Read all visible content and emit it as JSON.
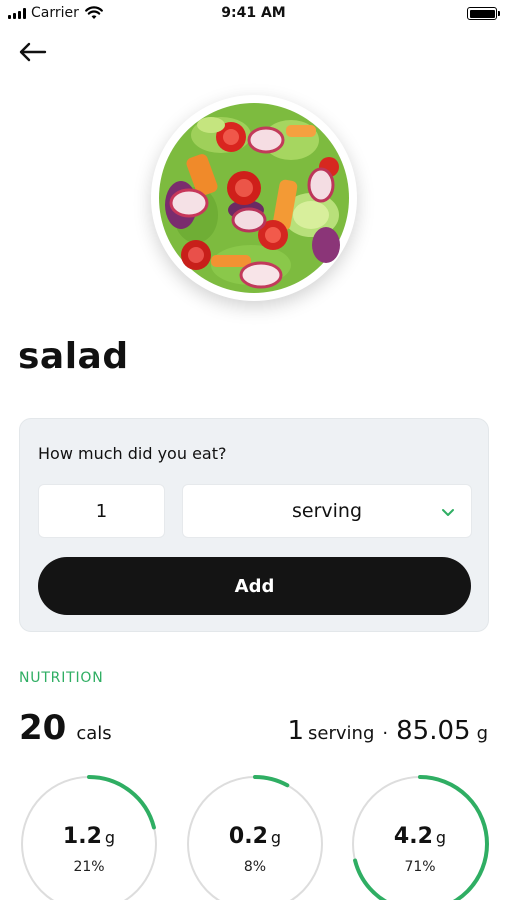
{
  "status_bar": {
    "carrier": "Carrier",
    "time": "9:41 AM"
  },
  "food": {
    "name": "salad"
  },
  "amount_card": {
    "question": "How much did you eat?",
    "quantity": "1",
    "unit": "serving",
    "add_label": "Add"
  },
  "nutrition": {
    "section_label": "NUTRITION",
    "calories_value": "20",
    "calories_unit": "cals",
    "serving_qty": "1",
    "serving_unit": "serving",
    "separator": "·",
    "serving_weight": "85.05",
    "serving_weight_unit": "g",
    "macros": [
      {
        "value": "1.2",
        "unit": "g",
        "percent_label": "21%",
        "fraction": 0.21
      },
      {
        "value": "0.2",
        "unit": "g",
        "percent_label": "8%",
        "fraction": 0.08
      },
      {
        "value": "4.2",
        "unit": "g",
        "percent_label": "71%",
        "fraction": 0.71
      }
    ]
  },
  "colors": {
    "accent": "#2fae63",
    "ring_track": "#dddddd",
    "card_bg": "#eef1f4",
    "button_bg": "#141414"
  }
}
